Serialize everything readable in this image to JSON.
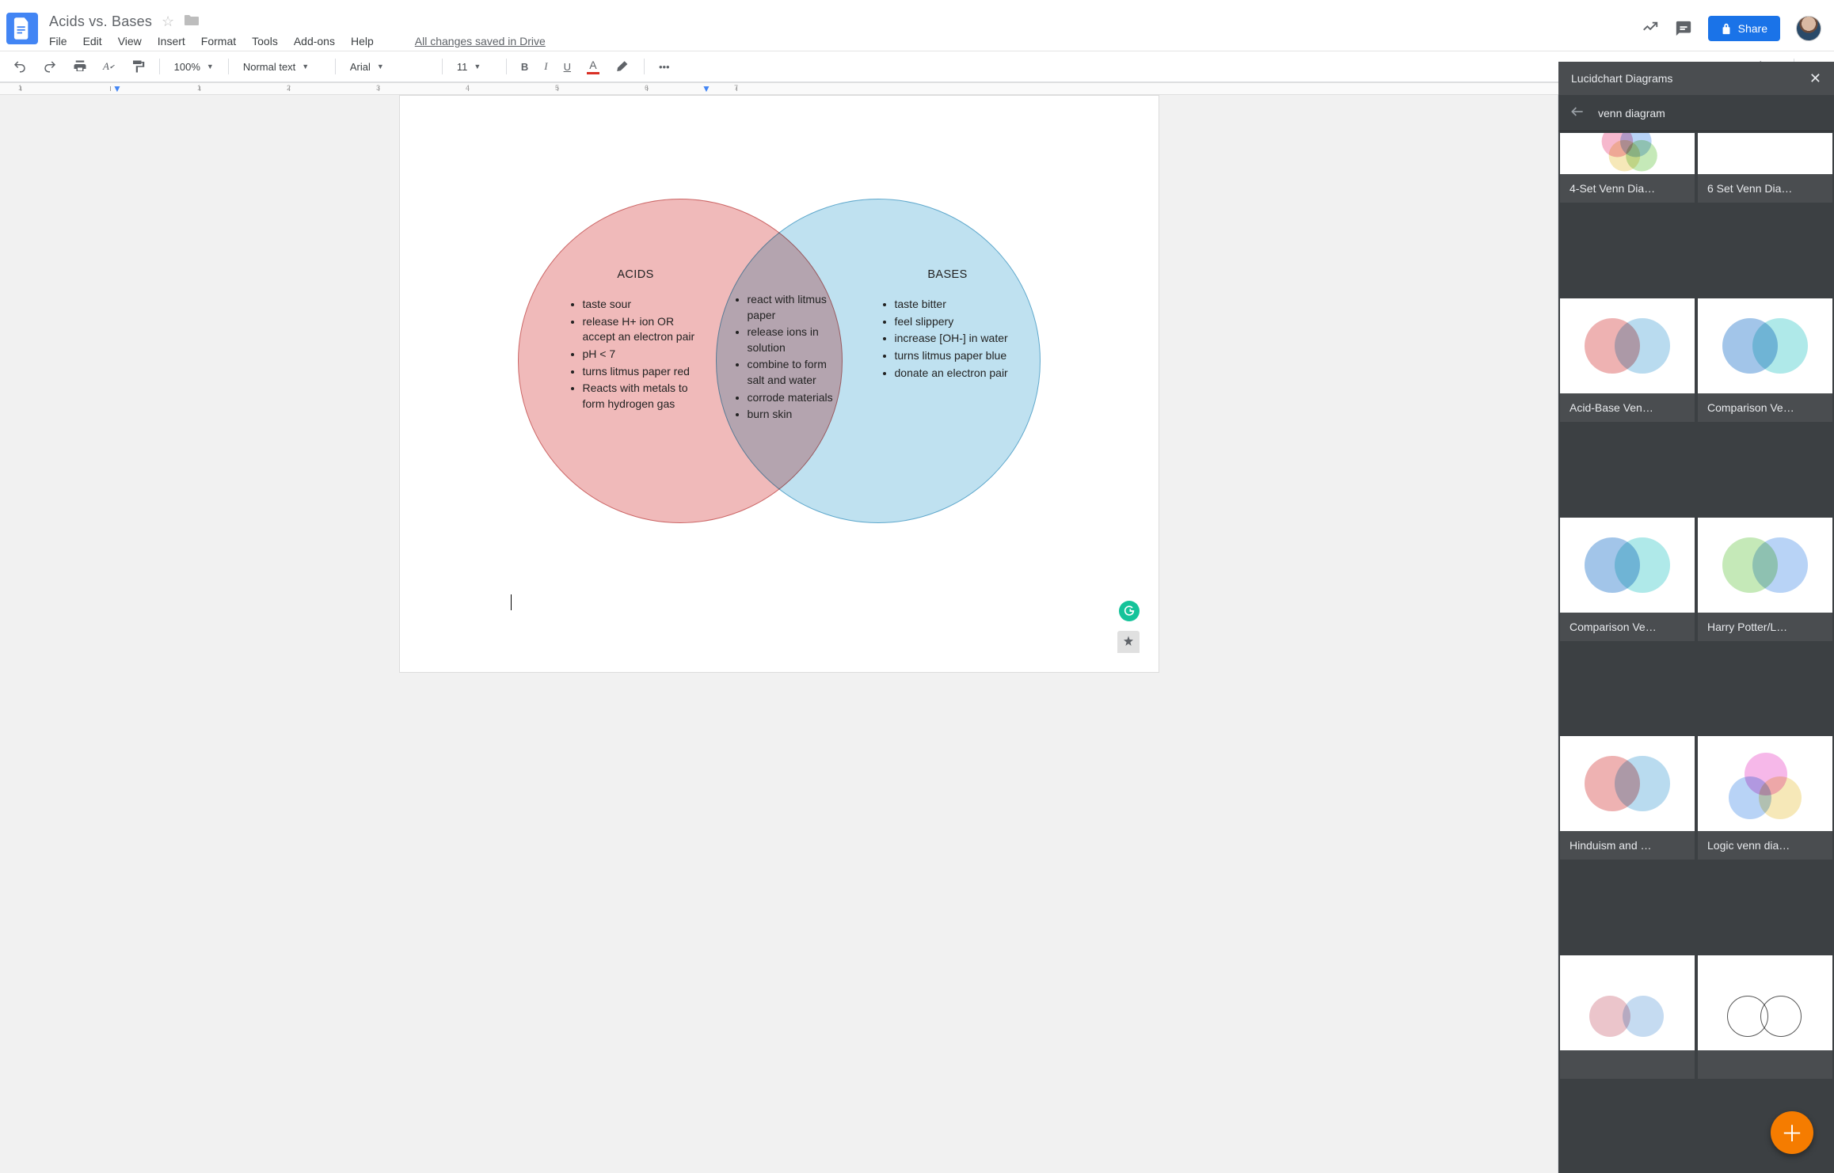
{
  "doc": {
    "title": "Acids vs. Bases",
    "saved_msg": "All changes saved in Drive"
  },
  "menu": [
    "File",
    "Edit",
    "View",
    "Insert",
    "Format",
    "Tools",
    "Add-ons",
    "Help"
  ],
  "toolbar": {
    "zoom": "100%",
    "style": "Normal text",
    "font": "Arial",
    "size": "11"
  },
  "share_label": "Share",
  "ruler": [
    "1",
    "",
    "1",
    "2",
    "3",
    "4",
    "5",
    "6",
    "7"
  ],
  "venn": {
    "left_title": "ACIDS",
    "right_title": "BASES",
    "left_items": [
      "taste sour",
      "release H+ ion OR accept an electron pair",
      "pH < 7",
      "turns litmus paper red",
      "Reacts with metals to form hydrogen gas"
    ],
    "mid_items": [
      "react with litmus paper",
      "release ions in solution",
      "combine to form salt and water",
      "corrode materials",
      "burn skin"
    ],
    "right_items": [
      "taste bitter",
      "feel slippery",
      "increase [OH-] in water",
      "turns litmus paper blue",
      "donate an electron pair"
    ]
  },
  "sidepanel": {
    "title": "Lucidchart Diagrams",
    "search_value": "venn diagram",
    "tiles": [
      "4-Set Venn Dia…",
      "6 Set Venn Dia…",
      "Acid-Base Ven…",
      "Comparison Ve…",
      "Comparison Ve…",
      "Harry Potter/L…",
      "Hinduism and …",
      "Logic venn dia…",
      "",
      ""
    ]
  }
}
